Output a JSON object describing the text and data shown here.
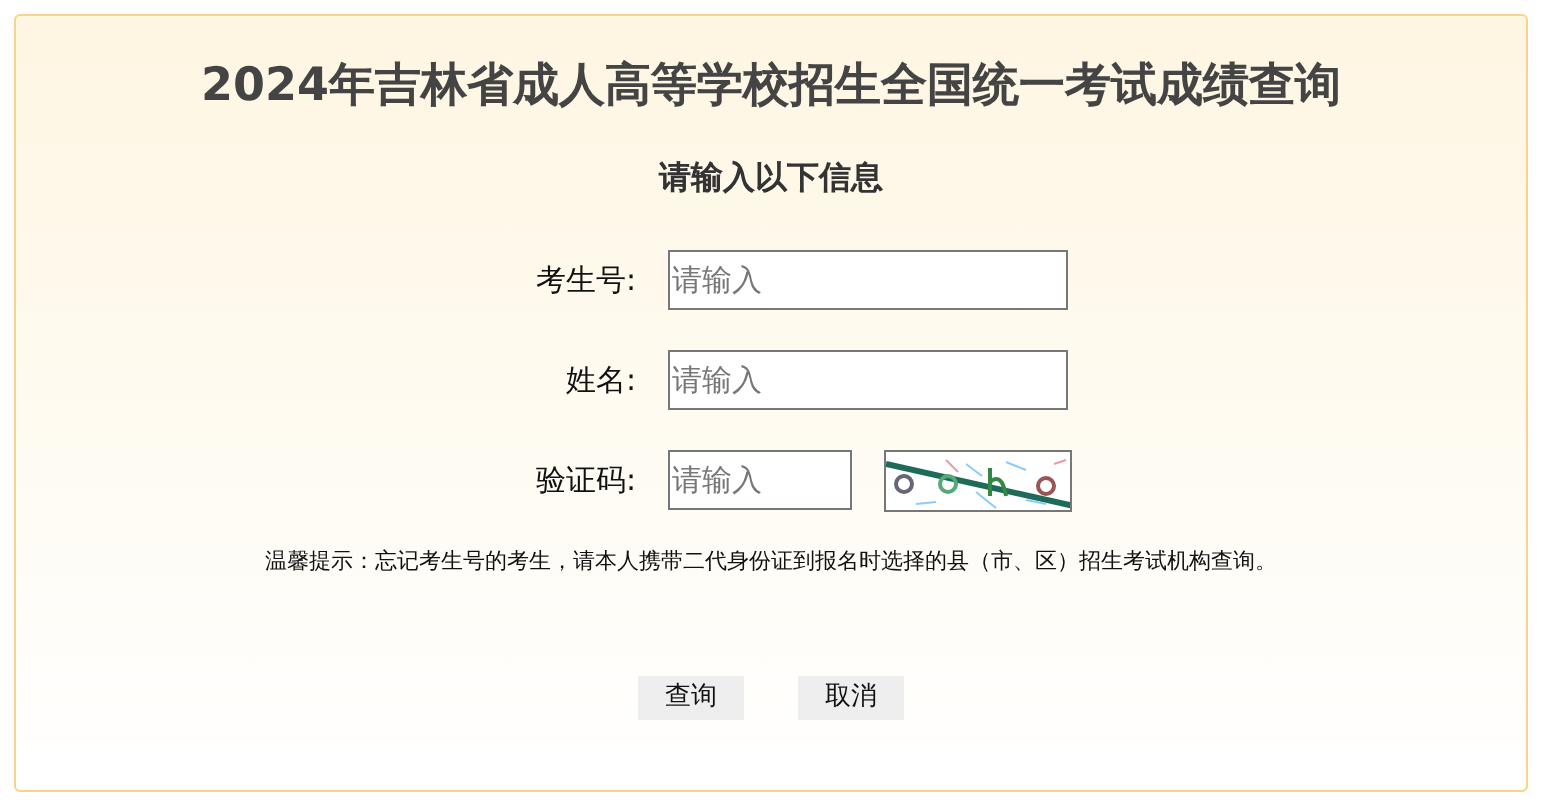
{
  "title": "2024年吉林省成人高等学校招生全国统一考试成绩查询",
  "subtitle": "请输入以下信息",
  "fields": [
    {
      "kind": "text",
      "label": "考生号:",
      "placeholder": "请输入"
    },
    {
      "kind": "text",
      "label": "姓名:",
      "placeholder": "请输入"
    },
    {
      "kind": "captcha",
      "label": "验证码:",
      "placeholder": "请输入"
    }
  ],
  "notice": "温馨提示：忘记考生号的考生，请本人携带二代身份证到报名时选择的县（市、区）招生考试机构查询。",
  "buttons": [
    "查询",
    "取消"
  ]
}
